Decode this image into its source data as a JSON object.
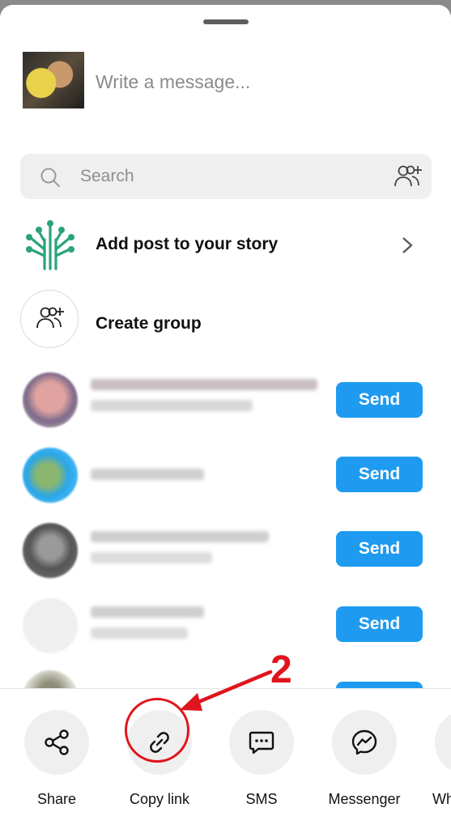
{
  "compose": {
    "placeholder": "Write a message..."
  },
  "search": {
    "placeholder": "Search"
  },
  "story_row": {
    "label": "Add post to your story"
  },
  "group_row": {
    "label": "Create group"
  },
  "contacts": [
    {
      "send_label": "Send"
    },
    {
      "send_label": "Send"
    },
    {
      "send_label": "Send"
    },
    {
      "send_label": "Send"
    }
  ],
  "share_options": [
    {
      "label": "Share",
      "icon": "share-icon"
    },
    {
      "label": "Copy link",
      "icon": "link-icon"
    },
    {
      "label": "SMS",
      "icon": "sms-icon"
    },
    {
      "label": "Messenger",
      "icon": "messenger-icon"
    },
    {
      "label": "Wh",
      "icon": "whatsapp-icon"
    }
  ],
  "annotation": {
    "step_number": "2",
    "color": "#e0141c"
  },
  "colors": {
    "accent": "#1e9bf0",
    "story_icon": "#2ba37a"
  }
}
